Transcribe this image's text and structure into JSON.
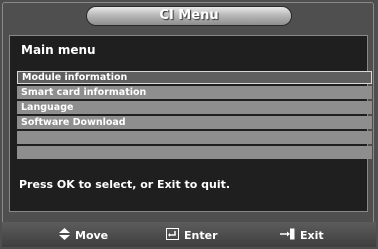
{
  "title": "CI Menu",
  "main_menu_label": "Main menu",
  "menu_items": [
    {
      "label": "Module information",
      "selected": true
    },
    {
      "label": "Smart card information",
      "selected": false
    },
    {
      "label": "Language",
      "selected": false
    },
    {
      "label": "Software Download",
      "selected": false
    },
    {
      "label": "",
      "selected": false
    },
    {
      "label": "",
      "selected": false
    }
  ],
  "hint": "Press OK to select, or Exit to quit.",
  "nav": {
    "move_label": "Move",
    "enter_label": "Enter",
    "exit_label": "Exit",
    "move_icon": "up-down-arrows-icon",
    "enter_icon": "enter-icon",
    "exit_icon": "exit-icon"
  },
  "colors": {
    "background": "#4f4f4f",
    "panel": "#1f1f1f",
    "item": "#8e8e8e",
    "selected_item": "#5f5f5f",
    "text": "#ffffff"
  }
}
